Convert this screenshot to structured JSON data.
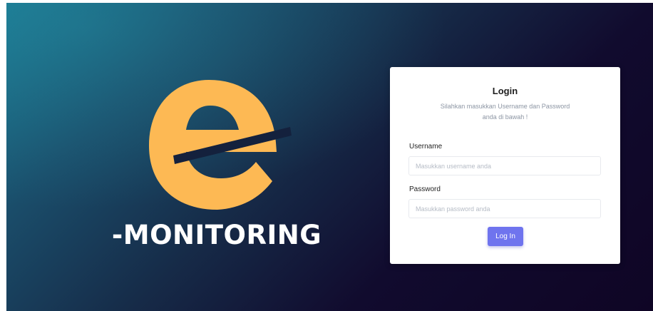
{
  "brand": {
    "logo_letter": "e",
    "logo_text": "-MONITORING",
    "logo_color": "#fdb954",
    "logo_icon": "e-monitoring-logo"
  },
  "login": {
    "title": "Login",
    "subtitle": "Silahkan masukkan Username dan Password anda di bawah !",
    "username_label": "Username",
    "username_placeholder": "Masukkan username anda",
    "username_value": "",
    "password_label": "Password",
    "password_placeholder": "Masukkan password anda",
    "password_value": "",
    "submit_label": "Log In",
    "accent_color": "#6f74ee"
  }
}
